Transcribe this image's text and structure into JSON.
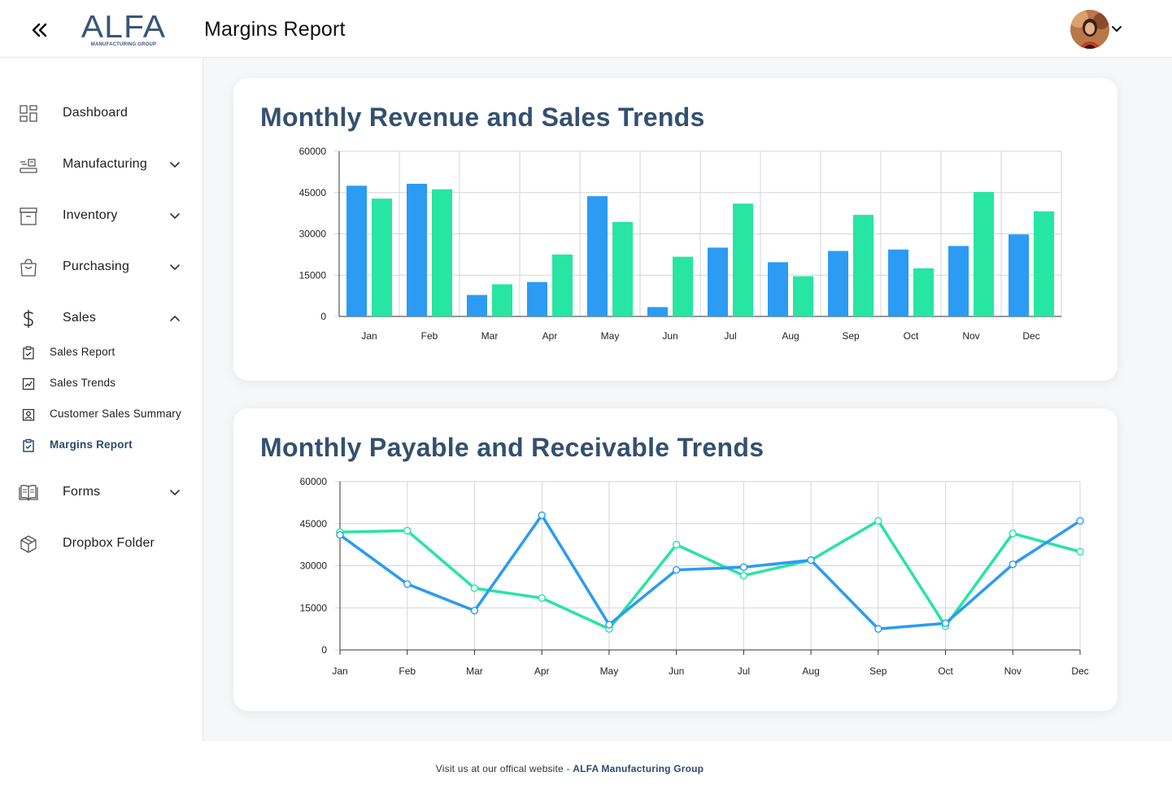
{
  "header": {
    "logo_text": "ALFA",
    "logo_subtext": "MANUFACTURING GROUP",
    "page_title": "Margins Report"
  },
  "sidebar": {
    "items": [
      {
        "label": "Dashboard",
        "icon": "dashboard-grid-icon"
      },
      {
        "label": "Manufacturing",
        "icon": "manufacturing-icon",
        "expandable": true
      },
      {
        "label": "Inventory",
        "icon": "archive-box-icon",
        "expandable": true
      },
      {
        "label": "Purchasing",
        "icon": "shopping-bag-icon",
        "expandable": true
      },
      {
        "label": "Sales",
        "icon": "dollar-icon",
        "expandable": true,
        "expanded": true
      },
      {
        "label": "Forms",
        "icon": "book-icon",
        "expandable": true
      },
      {
        "label": "Dropbox Folder",
        "icon": "package-icon"
      }
    ],
    "sales_sub": [
      {
        "label": "Sales Report",
        "icon": "clipboard-check-icon"
      },
      {
        "label": "Sales Trends",
        "icon": "trend-chart-icon"
      },
      {
        "label": "Customer Sales Summary",
        "icon": "user-card-icon"
      },
      {
        "label": "Margins Report",
        "icon": "clipboard-check-icon",
        "active": true
      }
    ]
  },
  "cards": {
    "revenue_title": "Monthly Revenue and Sales Trends",
    "payable_title": "Monthly Payable and Receivable Trends"
  },
  "colors": {
    "blue": "#2b9bf4",
    "green": "#27e5a2",
    "title": "#34506f",
    "brand": "#3a5678"
  },
  "chart_data": [
    {
      "type": "bar",
      "title": "Monthly Revenue and Sales Trends",
      "categories": [
        "Jan",
        "Feb",
        "Mar",
        "Apr",
        "May",
        "Jun",
        "Jul",
        "Aug",
        "Sep",
        "Oct",
        "Nov",
        "Dec"
      ],
      "series": [
        {
          "values": [
            47500,
            48200,
            7800,
            12500,
            43700,
            3400,
            25000,
            19700,
            23800,
            24300,
            25600,
            29800
          ],
          "color": "#2b9bf4"
        },
        {
          "values": [
            42800,
            46200,
            11700,
            22500,
            34300,
            21700,
            41000,
            14600,
            36900,
            17500,
            45200,
            38200
          ],
          "color": "#27e5a2"
        }
      ],
      "yticks": [
        0,
        15000,
        30000,
        45000,
        60000
      ],
      "ylim": [
        0,
        60000
      ],
      "grid": true
    },
    {
      "type": "line",
      "title": "Monthly Payable and Receivable Trends",
      "categories": [
        "Jan",
        "Feb",
        "Mar",
        "Apr",
        "May",
        "Jun",
        "Jul",
        "Aug",
        "Sep",
        "Oct",
        "Nov",
        "Dec"
      ],
      "series": [
        {
          "values": [
            41000,
            23500,
            14000,
            48000,
            9000,
            28500,
            29500,
            32000,
            7500,
            9500,
            30500,
            46000
          ],
          "color": "#2b9bf4"
        },
        {
          "values": [
            42000,
            42500,
            22000,
            18500,
            7500,
            37500,
            26500,
            32000,
            46000,
            8500,
            41500,
            35000
          ],
          "color": "#27e5a2"
        }
      ],
      "yticks": [
        0,
        15000,
        30000,
        45000,
        60000
      ],
      "ylim": [
        0,
        60000
      ],
      "grid": true
    }
  ],
  "footer": {
    "text": "Visit us at our offical website - ",
    "link_text": "ALFA Manufacturing Group"
  }
}
